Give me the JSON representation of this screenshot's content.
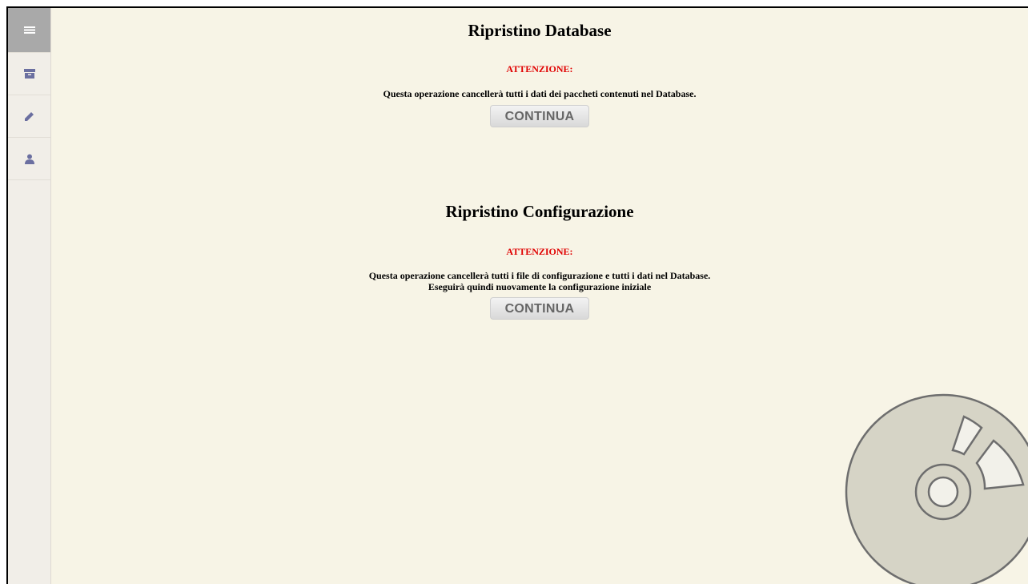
{
  "sidebar": {
    "items": [
      {
        "icon": "list-icon",
        "active": true
      },
      {
        "icon": "archive-icon",
        "active": false
      },
      {
        "icon": "pencil-icon",
        "active": false
      },
      {
        "icon": "user-icon",
        "active": false
      }
    ]
  },
  "database_section": {
    "title": "Ripristino Database",
    "warning": "ATTENZIONE:",
    "description": "Questa operazione cancellerà tutti i dati dei paccheti contenuti nel Database.",
    "button_label": "CONTINUA"
  },
  "config_section": {
    "title": "Ripristino Configurazione",
    "warning": "ATTENZIONE:",
    "description_line1": "Questa operazione cancellerà tutti i file di configurazione e tutti i dati nel Database.",
    "description_line2": "Eseguirà quindi nuovamente la configurazione iniziale",
    "button_label": "CONTINUA"
  },
  "colors": {
    "background": "#f7f4e6",
    "sidebar": "#f1eee8",
    "sidebar_active": "#a9a9a9",
    "icon": "#6b6fa0",
    "warning": "#e00000",
    "disc": "#d6d4c6"
  },
  "decoration": {
    "icon": "disc-icon"
  }
}
